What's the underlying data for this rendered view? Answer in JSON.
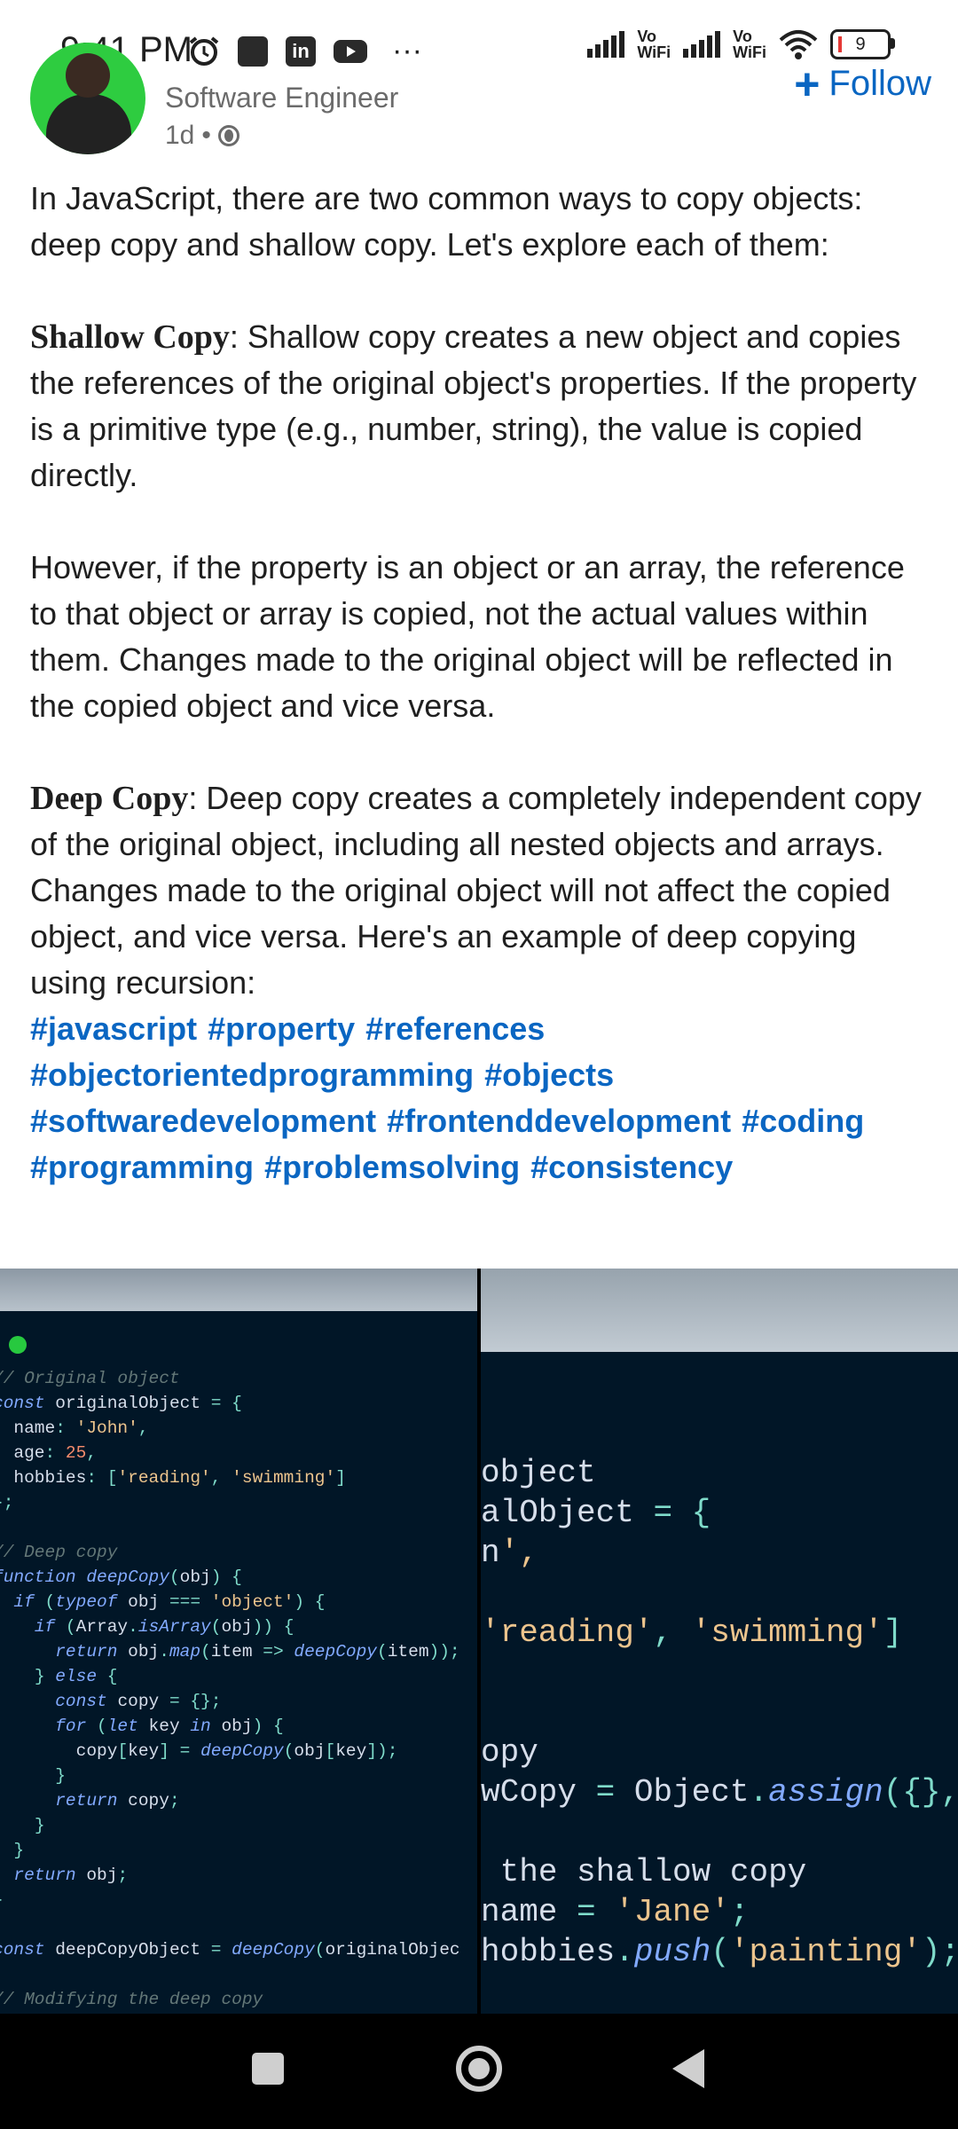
{
  "status_bar": {
    "time": "9:41 PM",
    "icons": [
      "alarm-icon",
      "app-square-icon",
      "linkedin-icon",
      "youtube-icon",
      "more-dots-icon"
    ],
    "linkedin_label": "in",
    "more_label": "···",
    "network_label": "Vo\nWiFi",
    "network_label_2": "Vo\nWiFi",
    "battery": "9"
  },
  "author": {
    "headline": "Software Engineer",
    "time": "1d",
    "follow_label": "Follow",
    "follow_plus": "+"
  },
  "post": {
    "intro": "In JavaScript, there are two common ways to copy objects: deep copy and shallow copy. Let's explore each of them:",
    "shallow_title": "Shallow Copy",
    "shallow_text": ": Shallow copy creates a new object and copies the references of the original object's properties. If the property is a primitive type (e.g., number, string), the value is copied directly.",
    "however": "However, if the property is an object or an array, the reference to that object or array is copied, not the actual values within them. Changes made to the original object will be reflected in the copied object and vice versa.",
    "deep_title": "Deep Copy",
    "deep_text": ": Deep copy creates a completely independent copy of the original object, including all nested objects and arrays. Changes made to the original object will not affect the copied object, and vice versa. Here's an example of deep copying using recursion:",
    "hashtags": [
      "#javascript",
      "#property",
      "#references",
      "#objectorientedprogramming",
      "#objects",
      "#softwaredevelopment",
      "#frontenddevelopment",
      "#coding",
      "#programming",
      "#problemsolving",
      "#consistency"
    ]
  },
  "images": {
    "left_code": [
      "// Original object",
      "const originalObject = {",
      "  name: 'John',",
      "  age: 25,",
      "  hobbies: ['reading', 'swimming']",
      "};",
      "",
      "// Deep copy",
      "function deepCopy(obj) {",
      "  if (typeof obj === 'object') {",
      "    if (Array.isArray(obj)) {",
      "      return obj.map(item => deepCopy(item));",
      "    } else {",
      "      const copy = {};",
      "      for (let key in obj) {",
      "        copy[key] = deepCopy(obj[key]);",
      "      }",
      "      return copy;",
      "    }",
      "  }",
      "  return obj;",
      "}",
      "",
      "const deepCopyObject = deepCopy(originalObjec",
      "",
      "// Modifying the deep copy"
    ],
    "right_code": [
      "object",
      "alObject = {",
      "n',",
      "",
      "'reading', 'swimming']",
      "",
      "",
      "opy",
      "wCopy = Object.assign({}, o",
      "",
      " the shallow copy",
      "name = 'Jane';",
      "hobbies.push('painting');"
    ]
  },
  "nav_bar": {
    "buttons": [
      "recents-button",
      "home-button",
      "back-button"
    ]
  }
}
